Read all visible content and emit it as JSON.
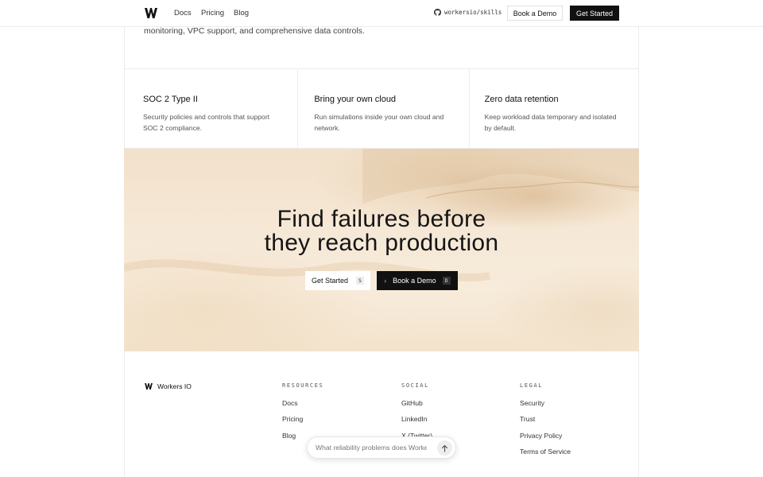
{
  "header": {
    "nav": [
      "Docs",
      "Pricing",
      "Blog"
    ],
    "github_label": "workersio/skills",
    "book_demo_label": "Book a Demo",
    "get_started_label": "Get Started"
  },
  "intro_text": "monitoring, VPC support, and comprehensive data controls.",
  "features": [
    {
      "title": "SOC 2 Type II",
      "description": "Security policies and controls that support SOC 2 compliance."
    },
    {
      "title": "Bring your own cloud",
      "description": "Run simulations inside your own cloud and network."
    },
    {
      "title": "Zero data retention",
      "description": "Keep workload data temporary and isolated by default."
    }
  ],
  "hero": {
    "title_line1": "Find failures before",
    "title_line2": "they reach production",
    "primary_label": "Get Started",
    "primary_key": "S",
    "secondary_label": "Book a Demo",
    "secondary_key": "D"
  },
  "footer": {
    "brand": "Workers IO",
    "columns": [
      {
        "heading": "RESOURCES",
        "links": [
          "Docs",
          "Pricing",
          "Blog"
        ]
      },
      {
        "heading": "SOCIAL",
        "links": [
          "GitHub",
          "LinkedIn",
          "X (Twitter)"
        ]
      },
      {
        "heading": "LEGAL",
        "links": [
          "Security",
          "Trust",
          "Privacy Policy",
          "Terms of Service"
        ]
      }
    ]
  },
  "chat": {
    "placeholder": "What reliability problems does Workers IO solve?"
  },
  "colors": {
    "accent_dark": "#111111",
    "hero_sand": "#f4e4cf"
  },
  "icons": [
    "workers-logo-icon",
    "github-icon",
    "chevron-right-icon",
    "arrow-up-icon"
  ]
}
